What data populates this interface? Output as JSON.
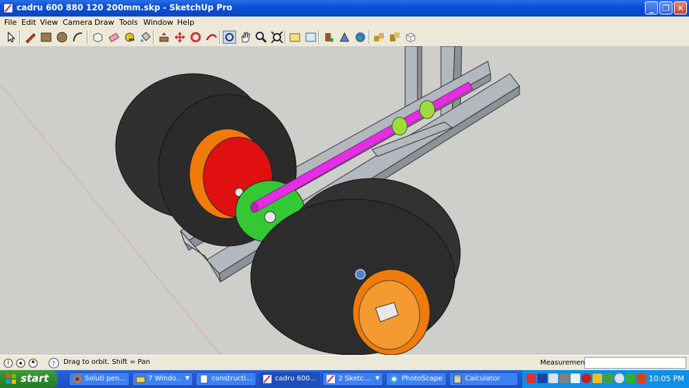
{
  "window": {
    "title": "cadru 600 880 120 200mm.skp - SketchUp Pro",
    "minimize": "_",
    "maximize": "❐",
    "close": "✕"
  },
  "menu": [
    "File",
    "Edit",
    "View",
    "Camera",
    "Draw",
    "Tools",
    "Window",
    "Help"
  ],
  "toolbar": {
    "tools": [
      "select-icon",
      "pencil-icon",
      "rectangle-icon",
      "circle-icon",
      "arc-icon",
      "eraser-icon",
      "paint-bucket-icon",
      "make-component-icon",
      "tape-measure-icon",
      "push-pull-icon",
      "move-icon",
      "rotate-icon",
      "follow-me-icon",
      "orbit-icon",
      "pan-icon",
      "zoom-icon",
      "zoom-extents-icon",
      "warehouse-icon",
      "share-model-icon",
      "get-models-icon",
      "google-earth-icon",
      "photo-textures-icon",
      "components-icon",
      "styles-icon"
    ]
  },
  "status": {
    "hint": "Drag to orbit.  Shift = Pan",
    "measurements_label": "Measurements",
    "measurements_value": ""
  },
  "taskbar": {
    "start": "start",
    "tasks": [
      {
        "label": "Soluti pen...",
        "icon": "firefox-icon",
        "arrow": false
      },
      {
        "label": "7 Windo...",
        "icon": "folder-icon",
        "arrow": true
      },
      {
        "label": "constructi...",
        "icon": "document-icon",
        "arrow": false
      },
      {
        "label": "cadru 600...",
        "icon": "sketchup-icon",
        "arrow": false
      },
      {
        "label": "2 Sketc...",
        "icon": "sketchup-icon",
        "arrow": true
      },
      {
        "label": "PhotoScape",
        "icon": "photoscape-icon",
        "arrow": false
      },
      {
        "label": "Calculator",
        "icon": "calculator-icon",
        "arrow": false
      }
    ],
    "clock": "10:05 PM"
  },
  "colors": {
    "frame": "#aeb4ba",
    "tire": "#2e2e2e",
    "axle": "#e62de6",
    "hub_red": "#e01010",
    "hub_orange": "#f07a0a",
    "green_part": "#34c834",
    "lime_bushing": "#9bdc3c"
  }
}
